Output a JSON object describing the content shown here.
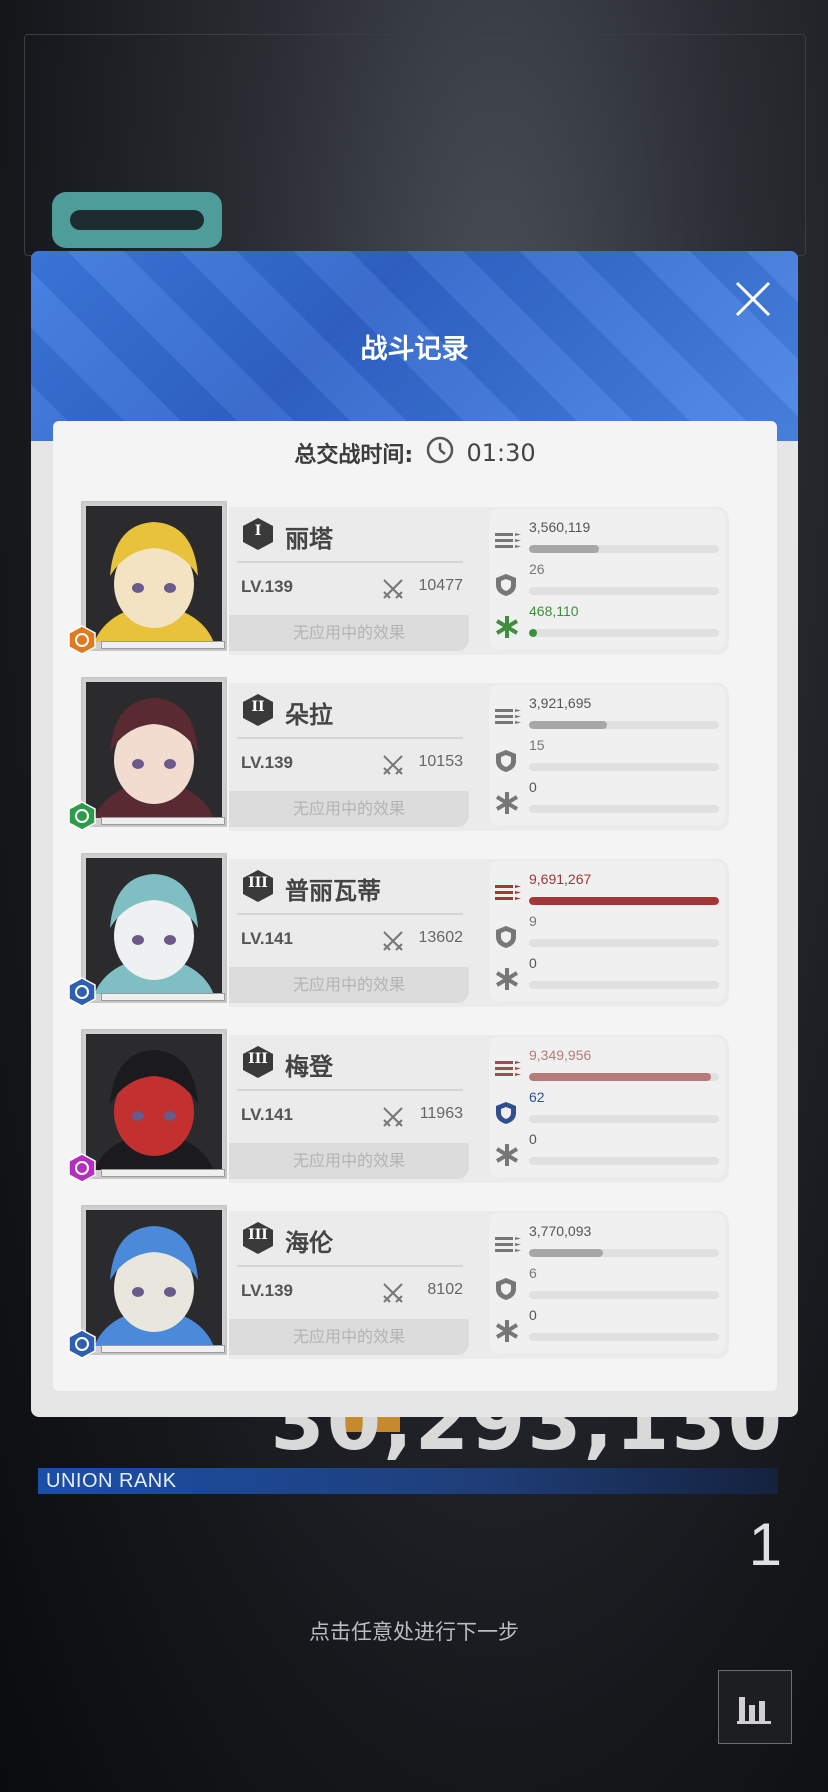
{
  "modal": {
    "title": "战斗记录",
    "battle_time_label": "总交战时间:",
    "battle_time": "01:30"
  },
  "background": {
    "score": "30,293,130",
    "union_rank_label": "UNION RANK",
    "rank": "1",
    "hint": "点击任意处进行下一步"
  },
  "colors": {
    "damage_gray": "#a7a7a7",
    "damage_red": "#a33636",
    "damage_pink": "#b77a7a",
    "heal_green": "#3e8e3e",
    "shield_blue": "#2f4f8f"
  },
  "characters": [
    {
      "rank": "I",
      "name": "丽塔",
      "level": "LV.139",
      "power": "10477",
      "effect": "无应用中的效果",
      "element_icon": "iron-element-icon",
      "element_color": "#e07a1e",
      "damage": "3,560,119",
      "damage_ratio": 0.37,
      "damage_color": "#a7a7a7",
      "damage_icon_color": "#777",
      "shield": "26",
      "shield_ratio": 0.0,
      "shield_color": "#777",
      "heal": "468,110",
      "heal_ratio": 0.04,
      "heal_color": "#3e8e3e",
      "heal_icon_color": "#3e8e3e"
    },
    {
      "rank": "II",
      "name": "朵拉",
      "level": "LV.139",
      "power": "10153",
      "effect": "无应用中的效果",
      "element_icon": "wind-element-icon",
      "element_color": "#2f9a4a",
      "damage": "3,921,695",
      "damage_ratio": 0.41,
      "damage_color": "#a7a7a7",
      "damage_icon_color": "#777",
      "shield": "15",
      "shield_ratio": 0.0,
      "shield_color": "#777",
      "heal": "0",
      "heal_ratio": 0.0,
      "heal_color": "#777",
      "heal_icon_color": "#777"
    },
    {
      "rank": "III",
      "name": "普丽瓦蒂",
      "level": "LV.141",
      "power": "13602",
      "effect": "无应用中的效果",
      "element_icon": "water-element-icon",
      "element_color": "#2f5fb0",
      "damage": "9,691,267",
      "damage_ratio": 1.0,
      "damage_color": "#a33636",
      "damage_icon_color": "#a33636",
      "shield": "9",
      "shield_ratio": 0.0,
      "shield_color": "#777",
      "heal": "0",
      "heal_ratio": 0.0,
      "heal_color": "#777",
      "heal_icon_color": "#777"
    },
    {
      "rank": "III",
      "name": "梅登",
      "level": "LV.141",
      "power": "11963",
      "effect": "无应用中的效果",
      "element_icon": "electric-element-icon",
      "element_color": "#b52fbf",
      "damage": "9,349,956",
      "damage_ratio": 0.96,
      "damage_color": "#b77a7a",
      "damage_icon_color": "#9a5050",
      "shield": "62",
      "shield_ratio": 0.0,
      "shield_color": "#2f4f8f",
      "heal": "0",
      "heal_ratio": 0.0,
      "heal_color": "#777",
      "heal_icon_color": "#777"
    },
    {
      "rank": "III",
      "name": "海伦",
      "level": "LV.139",
      "power": "8102",
      "effect": "无应用中的效果",
      "element_icon": "water-element-icon",
      "element_color": "#2f5fb0",
      "damage": "3,770,093",
      "damage_ratio": 0.39,
      "damage_color": "#a7a7a7",
      "damage_icon_color": "#777",
      "shield": "6",
      "shield_ratio": 0.0,
      "shield_color": "#777",
      "heal": "0",
      "heal_ratio": 0.0,
      "heal_color": "#777",
      "heal_icon_color": "#777"
    }
  ]
}
